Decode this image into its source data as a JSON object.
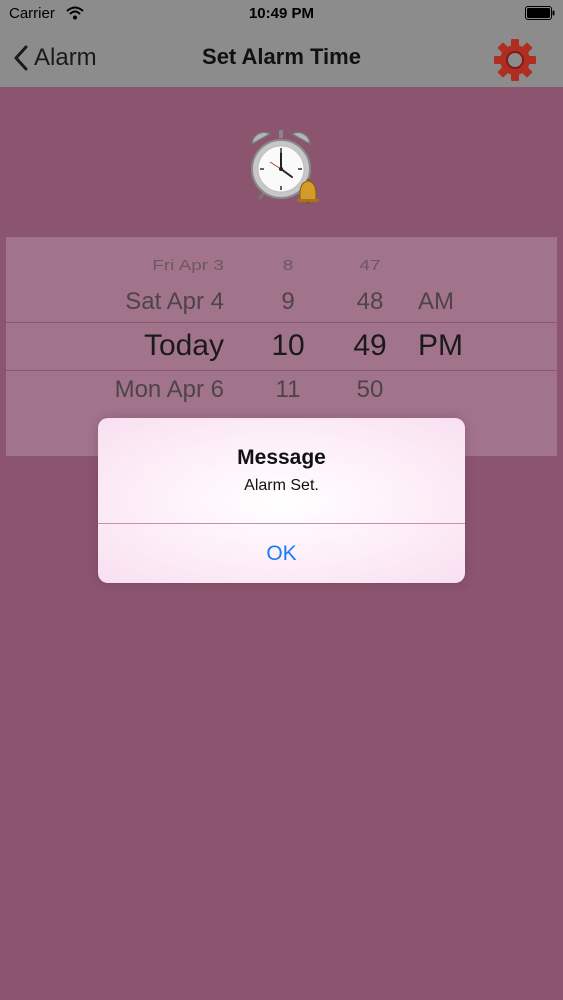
{
  "status_bar": {
    "carrier": "Carrier",
    "time": "10:49 PM"
  },
  "nav": {
    "back_label": "Alarm",
    "title": "Set Alarm Time",
    "settings_icon": "gear-icon"
  },
  "picker": {
    "rows": [
      {
        "date": "Fri Apr 3",
        "hour": "8",
        "minute": "47",
        "ampm": ""
      },
      {
        "date": "Sat Apr 4",
        "hour": "9",
        "minute": "48",
        "ampm": "AM"
      },
      {
        "date": "Today",
        "hour": "10",
        "minute": "49",
        "ampm": "PM"
      },
      {
        "date": "Mon Apr 6",
        "hour": "11",
        "minute": "50",
        "ampm": ""
      }
    ]
  },
  "alert": {
    "title": "Message",
    "message": "Alarm Set.",
    "ok_label": "OK"
  },
  "colors": {
    "background": "#8b546f",
    "bar": "#8c8c8c",
    "accent": "#1d7bf0",
    "gear": "#b12d22"
  }
}
